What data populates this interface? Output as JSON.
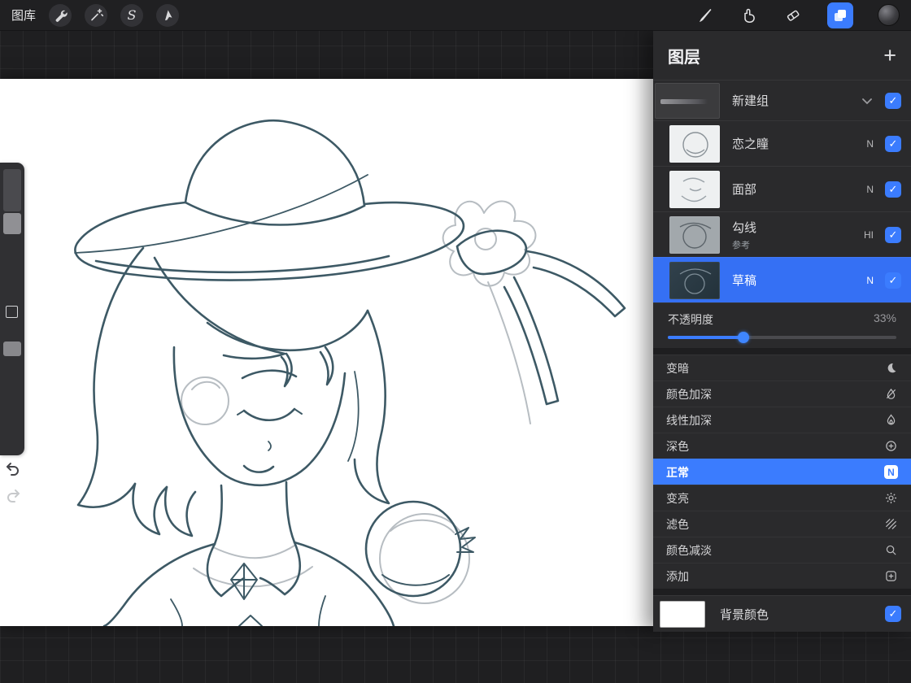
{
  "topbar": {
    "gallery_label": "图库"
  },
  "panel": {
    "title": "图层",
    "add_glyph": "+",
    "rows": [
      {
        "name": "新建组",
        "type": "group"
      },
      {
        "name": "恋之瞳",
        "badge": "N"
      },
      {
        "name": "面部",
        "badge": "N"
      },
      {
        "name": "勾线",
        "badge": "HI",
        "subtitle": "参考"
      },
      {
        "name": "草稿",
        "badge": "N",
        "selected": true
      }
    ],
    "opacity": {
      "label": "不透明度",
      "value": "33%",
      "percent": 33
    },
    "blend_modes": [
      {
        "label": "变暗",
        "icon": "moon-icon"
      },
      {
        "label": "颜色加深",
        "icon": "color-burn-icon"
      },
      {
        "label": "线性加深",
        "icon": "flame-icon"
      },
      {
        "label": "深色",
        "icon": "darker-color-icon"
      },
      {
        "label": "正常",
        "icon": "normal-n-icon",
        "badge": "N",
        "selected": true
      },
      {
        "label": "变亮",
        "icon": "sun-icon"
      },
      {
        "label": "滤色",
        "icon": "screen-icon"
      },
      {
        "label": "颜色减淡",
        "icon": "color-dodge-icon"
      },
      {
        "label": "添加",
        "icon": "add-icon"
      }
    ],
    "background_row": {
      "label": "背景颜色"
    },
    "accent_color": "#3b7cfe"
  },
  "tool_glyphs": {
    "selection": "S"
  }
}
